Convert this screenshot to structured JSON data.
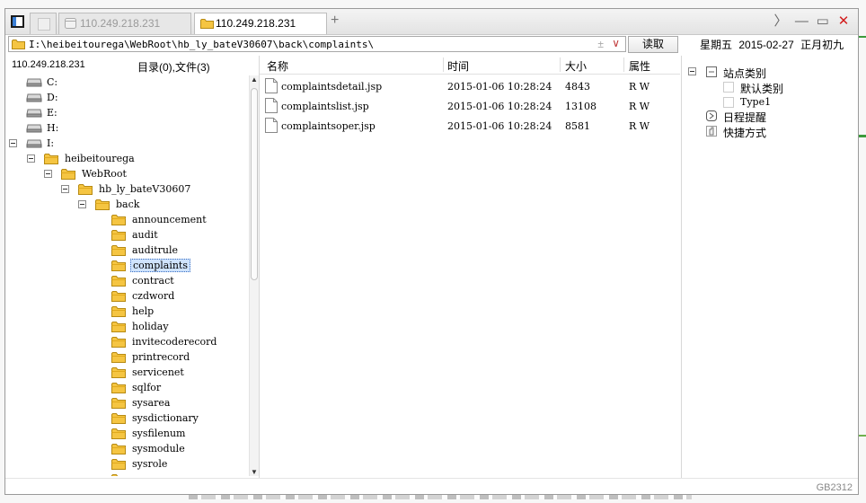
{
  "window": {
    "tabs": [
      {
        "label": "110.249.218.231",
        "active": false
      },
      {
        "label": "110.249.218.231",
        "active": true
      }
    ],
    "new_tab": "+",
    "controls": {
      "scroll_right": "〉",
      "minimize": "—",
      "maximize": "▭",
      "close": "✕"
    }
  },
  "address": {
    "path": "I:\\heibeitourega\\WebRoot\\hb_ly_bateV30607\\back\\complaints\\",
    "plus_minus": "±",
    "dropdown": "∨"
  },
  "read_button": "读取",
  "date": {
    "weekday": "星期五",
    "date": "2015-02-27",
    "lunar": "正月初九"
  },
  "left_header": {
    "host": "110.249.218.231",
    "counts": "目录(0),文件(3)"
  },
  "tree": {
    "drives": [
      "C:",
      "D:",
      "E:",
      "H:"
    ],
    "open_drive": "I:",
    "path_nodes": [
      "heibeitourega",
      "WebRoot",
      "hb_ly_bateV30607",
      "back"
    ],
    "folders": [
      "announcement",
      "audit",
      "auditrule",
      "complaints",
      "contract",
      "czdword",
      "help",
      "holiday",
      "invitecoderecord",
      "printrecord",
      "servicenet",
      "sqlfor",
      "sysarea",
      "sysdictionary",
      "sysfilenum",
      "sysmodule",
      "sysrole"
    ],
    "selected": "complaints"
  },
  "scrollbar": {
    "up": "▲",
    "down": "▼"
  },
  "file_columns": {
    "name": "名称",
    "time": "时间",
    "size": "大小",
    "attr": "属性"
  },
  "files": [
    {
      "name": "complaintsdetail.jsp",
      "time": "2015-01-06 10:28:24",
      "size": "4843",
      "attr": "R W"
    },
    {
      "name": "complaintslist.jsp",
      "time": "2015-01-06 10:28:24",
      "size": "13108",
      "attr": "R W"
    },
    {
      "name": "complaintsoper.jsp",
      "time": "2015-01-06 10:28:24",
      "size": "8581",
      "attr": "R W"
    }
  ],
  "right_panel": {
    "site_category": "站点类别",
    "children": [
      "默认类别",
      "Type1"
    ],
    "schedule": "日程提醒",
    "shortcuts": "快捷方式"
  },
  "watermark": "GB2312",
  "colors": {
    "folder": "#f5c542",
    "selection": "#cfe3fc",
    "close": "#d21c1c"
  }
}
